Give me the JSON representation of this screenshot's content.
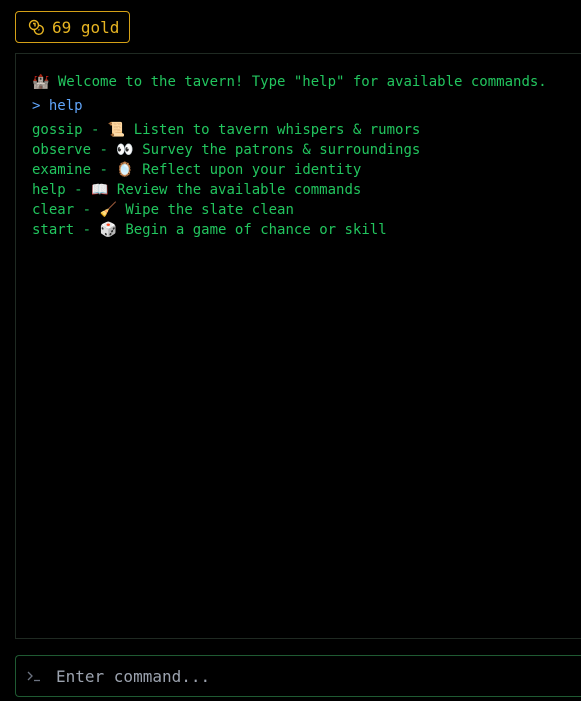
{
  "gold": {
    "amount_label": "69 gold",
    "icon": "coins-icon",
    "color": "#e6b422"
  },
  "terminal": {
    "welcome": {
      "icon": "🏰",
      "text": " Welcome to the tavern! Type \"help\" for available commands."
    },
    "echo": "> help",
    "commands": [
      {
        "name": "gossip",
        "icon": "📜",
        "desc": "Listen to tavern whispers & rumors"
      },
      {
        "name": "observe",
        "icon": "👀",
        "desc": "Survey the patrons & surroundings"
      },
      {
        "name": "examine",
        "icon": "🪞",
        "desc": "Reflect upon your identity"
      },
      {
        "name": "help",
        "icon": "📖",
        "desc": "Review the available commands"
      },
      {
        "name": "clear",
        "icon": "🧹",
        "desc": "Wipe the slate clean"
      },
      {
        "name": "start",
        "icon": "🎲",
        "desc": "Begin a game of chance or skill"
      }
    ]
  },
  "input": {
    "placeholder": "Enter command...",
    "icon": "terminal-prompt-icon"
  },
  "colors": {
    "text_green": "#22c55e",
    "echo_blue": "#60a5fa",
    "gold": "#e6b422"
  }
}
